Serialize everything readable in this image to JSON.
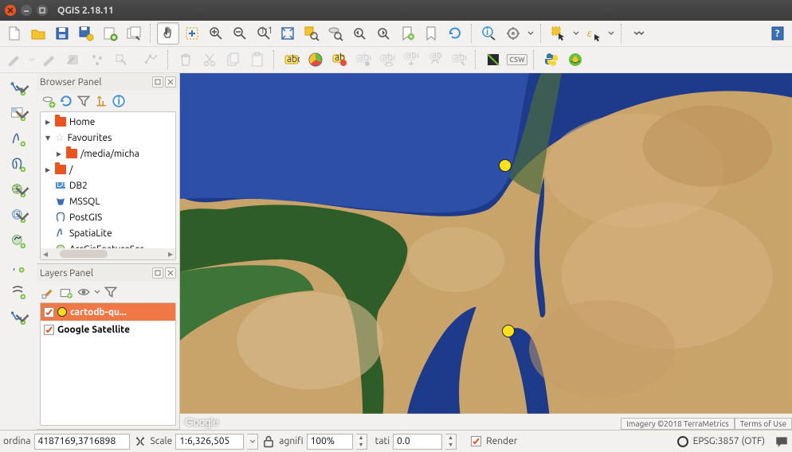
{
  "app": {
    "title": "QGIS 2.18.11"
  },
  "browser_panel": {
    "title": "Browser Panel",
    "items": {
      "home": "Home",
      "fav": "Favourites",
      "fav_child": "/media/micha",
      "root": "/",
      "db2": "DB2",
      "mssql": "MSSQL",
      "postgis": "PostGIS",
      "spatialite": "SpatiaLite",
      "arcgis": "ArcGisFeatureSer"
    }
  },
  "layers_panel": {
    "title": "Layers Panel",
    "layer1": "cartodb-qu...",
    "layer2": "Google Satellite"
  },
  "map": {
    "attribution_left": "Imagery ©2018 TerraMetrics",
    "attribution_right": "Terms of Use",
    "logo": "Google"
  },
  "status": {
    "coord_label": "ordina",
    "coord_value": "4187169,3716898",
    "scale_label": "Scale",
    "scale_value": "1:6,326,505",
    "magnifier_label": "agnifi",
    "magnifier_value": "100%",
    "rotation_label": "tati",
    "rotation_value": "0.0",
    "render_label": "Render",
    "crs": "EPSG:3857 (OTF)"
  }
}
